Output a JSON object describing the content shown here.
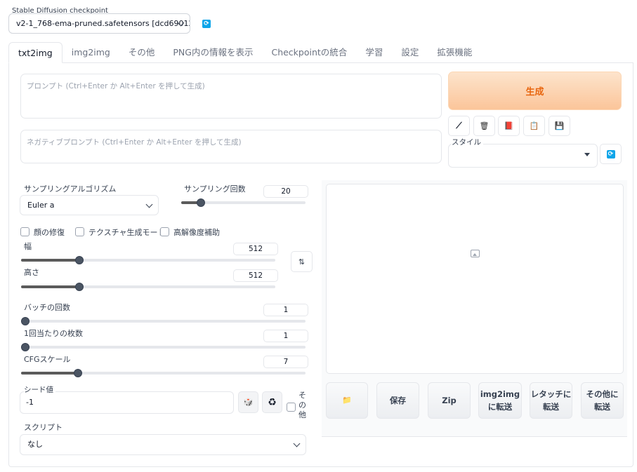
{
  "checkpoint": {
    "label": "Stable Diffusion checkpoint",
    "value": "v2-1_768-ema-pruned.safetensors [dcd690123c]",
    "refresh_icon": "refresh-icon"
  },
  "tabs": [
    {
      "label": "txt2img",
      "active": true
    },
    {
      "label": "img2img"
    },
    {
      "label": "その他"
    },
    {
      "label": "PNG内の情報を表示"
    },
    {
      "label": "Checkpointの統合"
    },
    {
      "label": "学習"
    },
    {
      "label": "設定"
    },
    {
      "label": "拡張機能"
    }
  ],
  "prompt": {
    "placeholder": "プロンプト (Ctrl+Enter か Alt+Enter を押して生成)"
  },
  "negative_prompt": {
    "placeholder": "ネガティブプロンプト (Ctrl+Enter か Alt+Enter を押して生成)"
  },
  "generate": {
    "label": "生成"
  },
  "tools": [
    {
      "icon": "pencil-icon",
      "glyph": "⟋"
    },
    {
      "icon": "trash-icon",
      "glyph": "🗑"
    },
    {
      "icon": "style-apply-icon",
      "glyph": "📕"
    },
    {
      "icon": "clipboard-icon",
      "glyph": "📋"
    },
    {
      "icon": "save-icon",
      "glyph": "💾"
    }
  ],
  "style": {
    "label": "スタイル"
  },
  "sampler": {
    "label": "サンプリングアルゴリズム",
    "value": "Euler a"
  },
  "steps": {
    "label": "サンプリング回数",
    "value": "20",
    "fraction": 0.16
  },
  "checkboxes": [
    {
      "label": "顔の修復"
    },
    {
      "label": "テクスチャ生成モード"
    },
    {
      "label": "高解像度補助"
    }
  ],
  "width": {
    "label": "幅",
    "value": "512",
    "fraction": 0.23
  },
  "height": {
    "label": "高さ",
    "value": "512",
    "fraction": 0.23
  },
  "swap": {
    "glyph": "⇅"
  },
  "batch_count": {
    "label": "バッチの回数",
    "value": "1",
    "fraction": 0.0
  },
  "batch_size": {
    "label": "1回当たりの枚数",
    "value": "1",
    "fraction": 0.0
  },
  "cfg": {
    "label": "CFGスケール",
    "value": "7",
    "fraction": 0.2
  },
  "seed": {
    "label": "シード値",
    "value": "-1",
    "extra_label": "その他"
  },
  "seed_icons": [
    {
      "icon": "dice-icon",
      "glyph": "🎲"
    },
    {
      "icon": "recycle-icon",
      "glyph": "♻"
    }
  ],
  "script": {
    "label": "スクリプト",
    "value": "なし"
  },
  "actions": [
    {
      "icon": "folder-icon",
      "glyph": "📁",
      "label": ""
    },
    {
      "label": "保存"
    },
    {
      "label": "Zip"
    },
    {
      "label": "img2img\nに転送"
    },
    {
      "label": "レタッチに\n転送"
    },
    {
      "label": "その他に\n転送"
    }
  ]
}
